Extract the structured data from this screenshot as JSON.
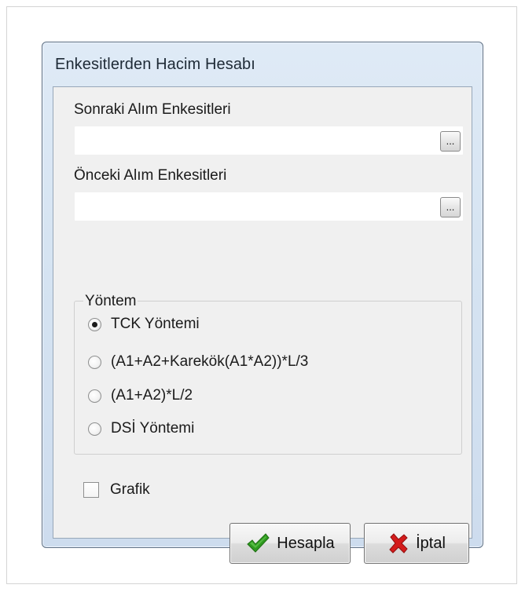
{
  "window": {
    "title": "Enkesitlerden Hacim Hesabı"
  },
  "fields": {
    "next_sections": {
      "label": "Sonraki Alım Enkesitleri",
      "value": "",
      "browse_label": "..."
    },
    "prev_sections": {
      "label": "Önceki Alım Enkesitleri",
      "value": "",
      "browse_label": "..."
    }
  },
  "method_group": {
    "legend": "Yöntem",
    "options": [
      {
        "label": "TCK Yöntemi",
        "checked": true
      },
      {
        "label": "(A1+A2+Karekök(A1*A2))*L/3",
        "checked": false
      },
      {
        "label": "(A1+A2)*L/2",
        "checked": false
      },
      {
        "label": "DSİ Yöntemi",
        "checked": false
      }
    ]
  },
  "graph_checkbox": {
    "label": "Grafik",
    "checked": false
  },
  "buttons": {
    "calculate": {
      "label": "Hesapla",
      "icon": "checkmark-icon"
    },
    "cancel": {
      "label": "İptal",
      "icon": "red-x-icon"
    }
  },
  "colors": {
    "title_bar": "#d6e4f2",
    "client_bg": "#f0f0f0",
    "ok_green": "#2e9a1f",
    "cancel_red": "#d41c1c"
  }
}
